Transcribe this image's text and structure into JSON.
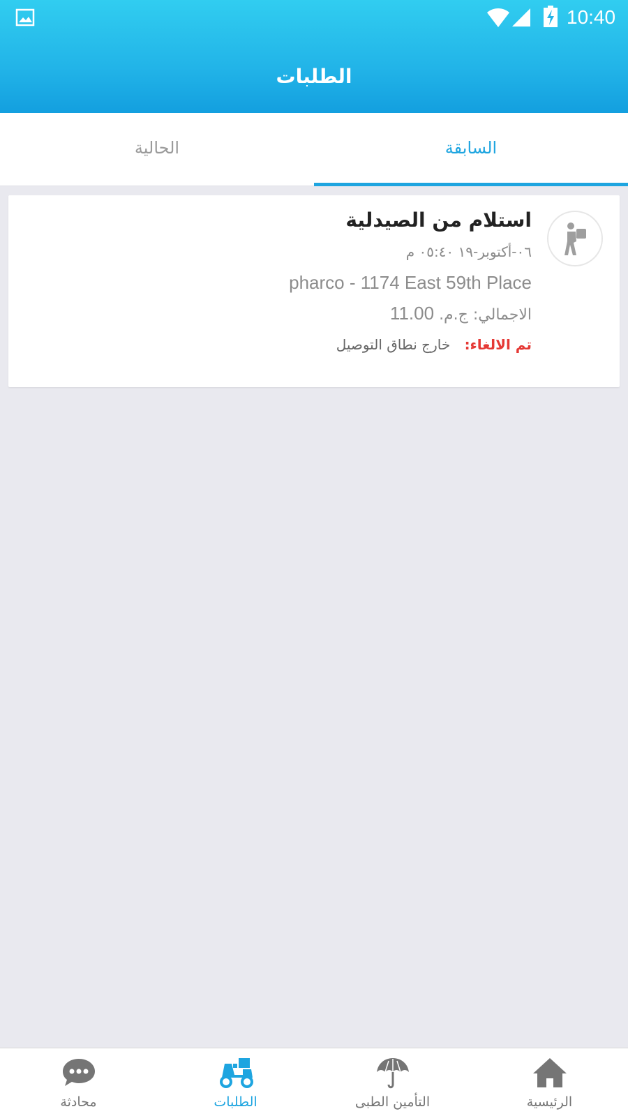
{
  "status_bar": {
    "time": "10:40",
    "icons": [
      "gallery-icon",
      "wifi-icon",
      "signal-icon",
      "battery-charging-icon"
    ]
  },
  "header": {
    "title": "الطلبات"
  },
  "tabs": [
    {
      "label": "السابقة",
      "selected": true
    },
    {
      "label": "الحالية",
      "selected": false
    }
  ],
  "orders": [
    {
      "title": "استلام من الصيدلية",
      "date": "٠٦-أكتوبر-١٩ ٠٥:٤٠ م",
      "pharmacy": "pharco - 1174 East 59th Place",
      "total_label": "الاجمالي: ج.م.",
      "total_amount": "11.00",
      "cancel_label": "تم الالغاء:",
      "cancel_reason": "خارج نطاق التوصيل",
      "icon": "pickup-walker-icon"
    }
  ],
  "bottom_nav": [
    {
      "label": "الرئيسية",
      "icon": "home-icon",
      "active": false
    },
    {
      "label": "التأمين الطبى",
      "icon": "umbrella-icon",
      "active": false
    },
    {
      "label": "الطلبات",
      "icon": "delivery-scooter-icon",
      "active": true
    },
    {
      "label": "محادثة",
      "icon": "chat-icon",
      "active": false
    }
  ],
  "colors": {
    "accent": "#1ea5e0",
    "header_top": "#31cdf0",
    "header_bottom": "#139fdf",
    "cancel": "#e53935",
    "background": "#e9e9ef"
  }
}
